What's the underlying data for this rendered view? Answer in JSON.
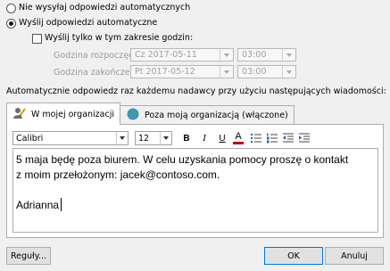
{
  "options": {
    "no_auto_reply": "Nie wysyłaj odpowiedzi automatycznych",
    "send_auto_reply": "Wyślij odpowiedzi automatyczne",
    "only_in_range": "Wyślij tylko w tym zakresie godzin:",
    "start_label": "Godzina rozpoczęcia:",
    "end_label": "Godzina zakończenia:",
    "start_date": "Cz 2017-05-11",
    "start_time": "03:00",
    "end_date": "Pt 2017-05-12",
    "end_time": "03:00"
  },
  "reply_caption": "Automatycznie odpowiedz raz każdemu nadawcy przy użyciu następujących wiadomości:",
  "tabs": [
    {
      "label": "W mojej organizacji"
    },
    {
      "label": "Poza moją organizacją (włączone)"
    }
  ],
  "toolbar": {
    "font": "Calibri",
    "size": "12",
    "bold": "B",
    "italic": "I",
    "underline": "U",
    "font_color": "A"
  },
  "message": {
    "line1": "5 maja będę poza biurem. W celu uzyskania pomocy proszę o kontakt",
    "line2": "z moim przełożonym: jacek@contoso.com.",
    "signature": "Adrianna"
  },
  "buttons": {
    "rules": "Reguły...",
    "ok": "OK",
    "cancel": "Anuluj"
  },
  "colors": {
    "font_color_bar": "#c00000",
    "primary_border": "#0078d7"
  }
}
